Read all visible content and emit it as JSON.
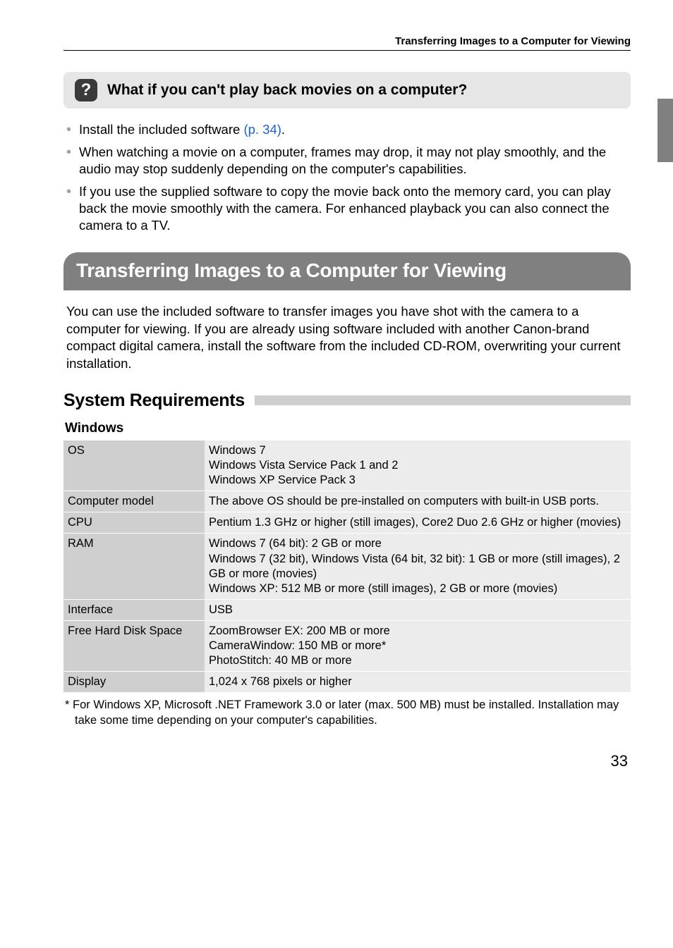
{
  "running_head": "Transferring Images to a Computer for Viewing",
  "callout": {
    "icon_text": "?",
    "title": "What if you can't play back movies on a computer?"
  },
  "tips": [
    {
      "prefix": "Install the included software ",
      "link": "(p. 34)",
      "suffix": "."
    },
    {
      "text": "When watching a movie on a computer, frames may drop, it may not play smoothly, and the audio may stop suddenly depending on the computer's capabilities."
    },
    {
      "text": "If you use the supplied software to copy the movie back onto the memory card, you can play back the movie smoothly with the camera. For enhanced playback you can also connect the camera to a TV."
    }
  ],
  "h1": "Transferring Images to a Computer for Viewing",
  "intro": "You can use the included software to transfer images you have shot with the camera to a computer for viewing. If you are already using software included with another Canon-brand compact digital camera, install the software from the included CD-ROM, overwriting your current installation.",
  "h2": "System Requirements",
  "h3": "Windows",
  "spec_rows": [
    {
      "label": "OS",
      "value": "Windows 7\nWindows Vista Service Pack 1 and 2\nWindows XP Service Pack 3"
    },
    {
      "label": "Computer model",
      "value": "The above OS should be pre-installed on computers with built-in USB ports."
    },
    {
      "label": "CPU",
      "value": "Pentium 1.3 GHz or higher (still images), Core2 Duo 2.6 GHz or higher (movies)"
    },
    {
      "label": "RAM",
      "value": "Windows 7 (64 bit): 2 GB or more\nWindows 7 (32 bit), Windows Vista (64 bit, 32 bit): 1 GB or more (still images), 2 GB or more (movies)\nWindows XP: 512 MB or more (still images), 2 GB or more (movies)"
    },
    {
      "label": "Interface",
      "value": "USB"
    },
    {
      "label": "Free Hard Disk Space",
      "value": "ZoomBrowser EX: 200 MB or more\nCameraWindow: 150 MB or more*\nPhotoStitch: 40 MB or more"
    },
    {
      "label": "Display",
      "value": "1,024 x 768 pixels or higher"
    }
  ],
  "footnote": "*  For Windows XP, Microsoft .NET Framework 3.0 or later (max. 500 MB) must be installed. Installation may take some time depending on your computer's capabilities.",
  "page_number": "33"
}
